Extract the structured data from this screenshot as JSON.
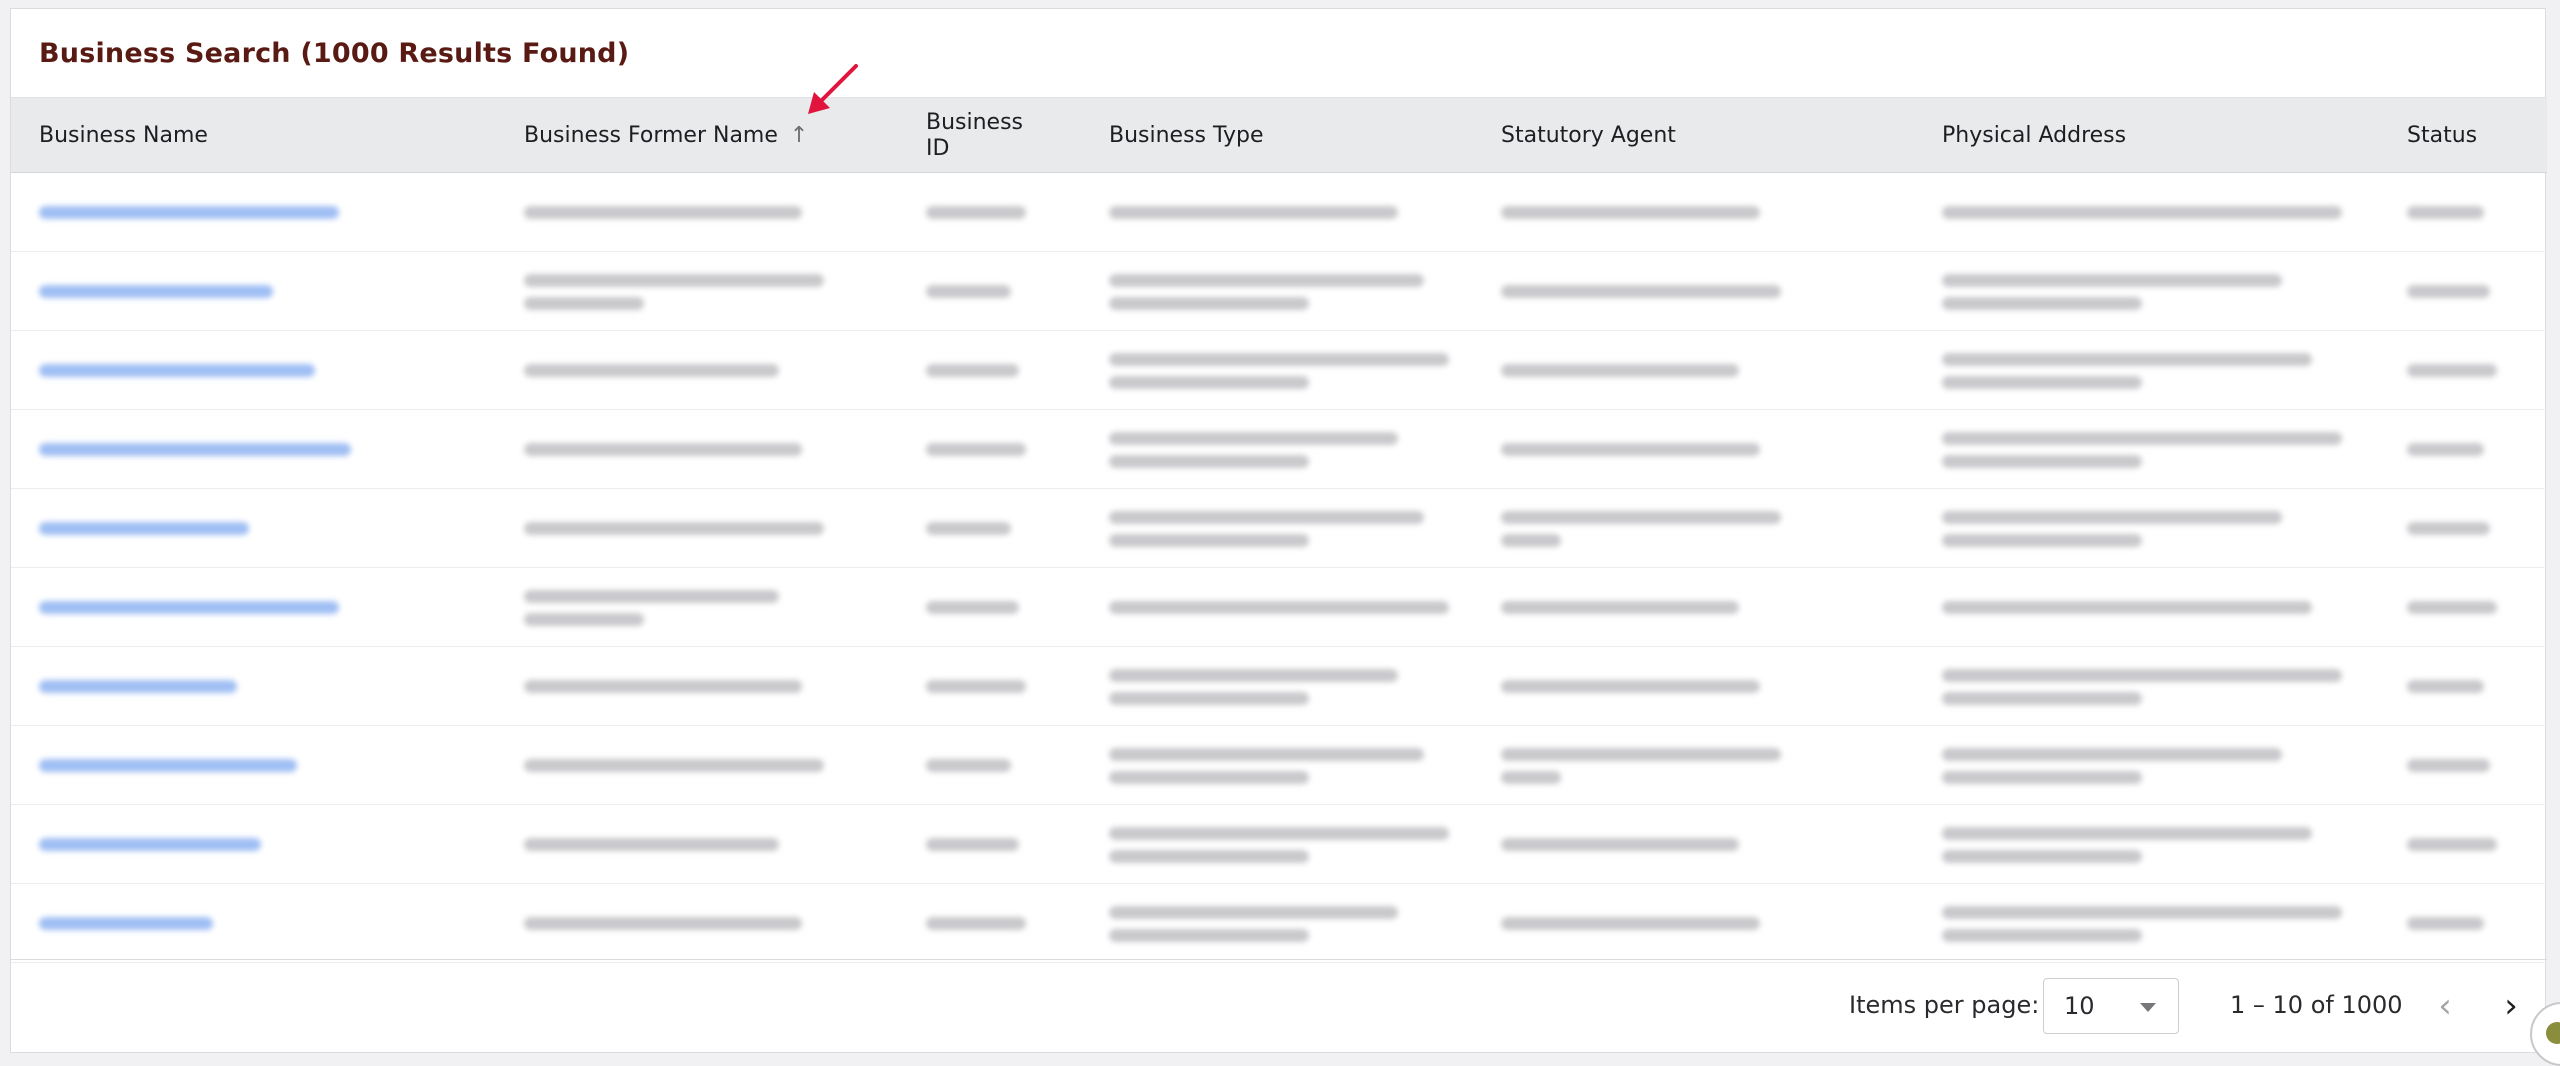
{
  "card": {
    "title": "Business Search (1000 Results Found)"
  },
  "columns": [
    {
      "label": "Business Name"
    },
    {
      "label": "Business Former Name"
    },
    {
      "label": "Business ID"
    },
    {
      "label": "Business Type"
    },
    {
      "label": "Statutory Agent"
    },
    {
      "label": "Physical Address"
    },
    {
      "label": "Status"
    }
  ],
  "sort": {
    "column": "Business Former Name",
    "direction": "ascending",
    "icon": "arrow-up-icon"
  },
  "rows": [
    {
      "blurred": true
    },
    {
      "blurred": true
    },
    {
      "blurred": true
    },
    {
      "blurred": true
    },
    {
      "blurred": true
    },
    {
      "blurred": true
    },
    {
      "blurred": true
    },
    {
      "blurred": true
    },
    {
      "blurred": true
    },
    {
      "blurred": true
    }
  ],
  "pagination": {
    "items_per_page_label": "Items per page:",
    "items_per_page_value": "10",
    "range_label": "1 – 10 of 1000",
    "prev_icon": "chevron-left-icon",
    "next_icon": "chevron-right-icon"
  },
  "colors": {
    "title": "#5a1a14",
    "header_bg": "#e9eaec",
    "link": "#8fb3f2",
    "annotation_arrow": "#e0143c"
  }
}
